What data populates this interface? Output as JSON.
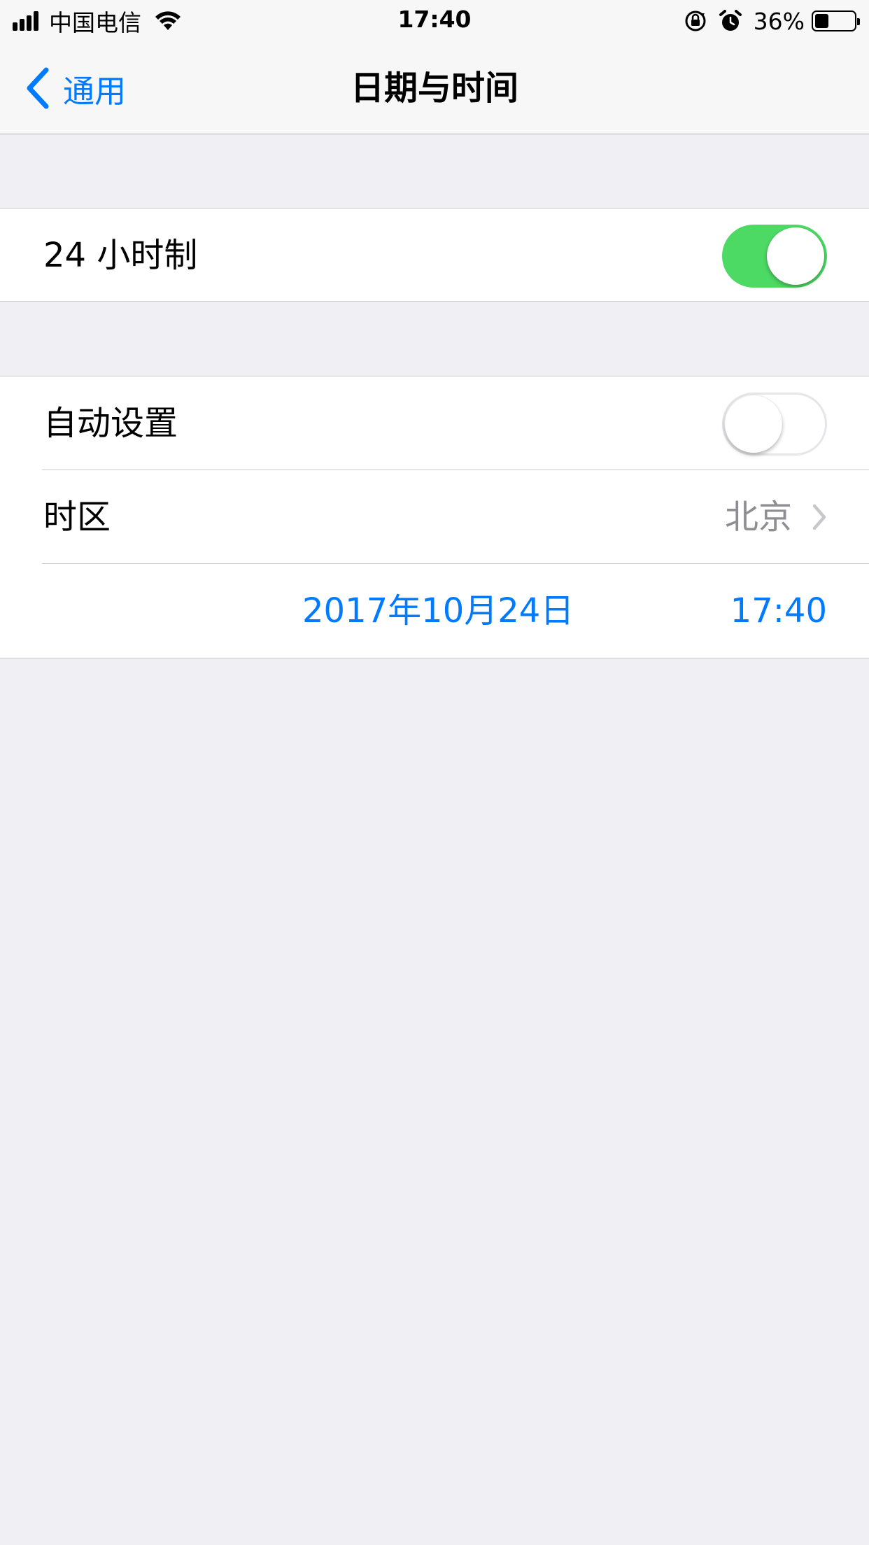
{
  "status_bar": {
    "carrier": "中国电信",
    "time": "17:40",
    "battery_percent": "36%",
    "battery_level": 0.36,
    "icons": [
      "signal-icon",
      "wifi-icon",
      "orientation-lock-icon",
      "alarm-icon",
      "battery-icon"
    ]
  },
  "nav": {
    "back_label": "通用",
    "title": "日期与时间"
  },
  "settings": {
    "hour24": {
      "label": "24 小时制",
      "enabled": true
    },
    "auto_set": {
      "label": "自动设置",
      "enabled": false
    },
    "timezone": {
      "label": "时区",
      "value": "北京"
    },
    "date": "2017年10月24日",
    "time": "17:40"
  },
  "colors": {
    "accent": "#007aff",
    "toggle_on": "#4cd964",
    "background": "#efeff4"
  }
}
